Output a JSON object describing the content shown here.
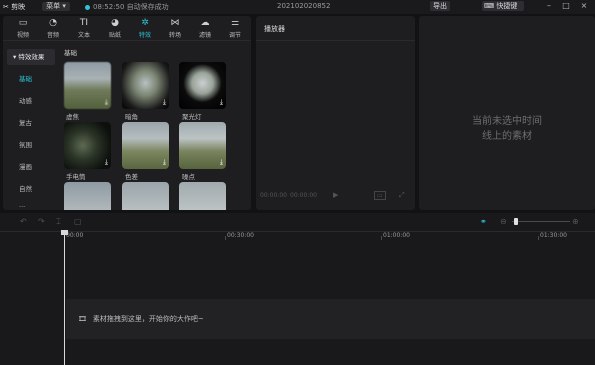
{
  "titlebar": {
    "app_name": "剪映",
    "menu": "菜单",
    "save_status": "08:52:50 自动保存成功",
    "project_name": "202102020852",
    "export": "导出",
    "shortcut": "快捷键"
  },
  "tabs": [
    {
      "label": "视频",
      "icon": "video-icon",
      "glyph": "▭"
    },
    {
      "label": "音频",
      "icon": "audio-icon",
      "glyph": "◔"
    },
    {
      "label": "文本",
      "icon": "text-icon",
      "glyph": "TI"
    },
    {
      "label": "贴纸",
      "icon": "sticker-icon",
      "glyph": "◕"
    },
    {
      "label": "特效",
      "icon": "effects-icon",
      "glyph": "✲"
    },
    {
      "label": "转场",
      "icon": "transition-icon",
      "glyph": "⋈"
    },
    {
      "label": "滤镜",
      "icon": "filter-icon",
      "glyph": "☁"
    },
    {
      "label": "调节",
      "icon": "adjust-icon",
      "glyph": "⚌"
    }
  ],
  "sidenav": {
    "group": "▾ 特效效果",
    "items": [
      "基础",
      "动感",
      "复古",
      "氛围",
      "漫画",
      "自然",
      "..."
    ]
  },
  "section_title": "基础",
  "effects": [
    "虚焦",
    "暗角",
    "聚光灯",
    "手电筒",
    "色差",
    "噪点",
    "",
    ""
  ],
  "player": {
    "title": "播放器",
    "time_current": "00:00:00",
    "time_total": "00:00:00"
  },
  "inspector": {
    "line1": "当前未选中时间",
    "line2": "线上的素材"
  },
  "timeline": {
    "ticks": [
      "00:00",
      "00:30:00",
      "01:00:00",
      "01:30:00"
    ],
    "hint": "素材拖拽到这里，开始你的大作吧~"
  },
  "colors": {
    "accent": "#2ec5d8"
  }
}
